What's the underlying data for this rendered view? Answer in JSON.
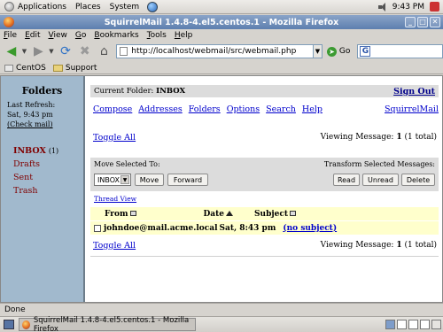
{
  "panel": {
    "applications": "Applications",
    "places": "Places",
    "system": "System",
    "clock": "9:43 PM"
  },
  "window": {
    "title": "SquirrelMail 1.4.8-4.el5.centos.1 - Mozilla Firefox",
    "controls": [
      "_",
      "□",
      "✕"
    ]
  },
  "menu": [
    {
      "label": "File",
      "key": "F",
      "rest": "ile"
    },
    {
      "label": "Edit",
      "key": "E",
      "rest": "dit"
    },
    {
      "label": "View",
      "key": "V",
      "rest": "iew"
    },
    {
      "label": "Go",
      "key": "G",
      "rest": "o"
    },
    {
      "label": "Bookmarks",
      "key": "B",
      "rest": "ookmarks"
    },
    {
      "label": "Tools",
      "key": "T",
      "rest": "ools"
    },
    {
      "label": "Help",
      "key": "H",
      "rest": "elp"
    }
  ],
  "nav": {
    "url": "http://localhost/webmail/src/webmail.php",
    "go_label": "Go"
  },
  "bookmarks": [
    "CentOS",
    "Support"
  ],
  "sidebar": {
    "title": "Folders",
    "refresh_label": "Last Refresh:",
    "refresh_time": "Sat, 9:43 pm",
    "check_mail": "(Check mail)",
    "folders": [
      {
        "name": "INBOX",
        "count": "(1)"
      },
      {
        "name": "Drafts"
      },
      {
        "name": "Sent"
      },
      {
        "name": "Trash"
      }
    ]
  },
  "main": {
    "current_folder_label": "Current Folder:",
    "current_folder": "INBOX",
    "sign_out": "Sign Out",
    "links": [
      "Compose",
      "Addresses",
      "Folders",
      "Options",
      "Search",
      "Help"
    ],
    "brand": "SquirrelMail",
    "toggle_all": "Toggle All",
    "viewing_prefix": "Viewing Message:",
    "viewing_num": "1",
    "viewing_total": "(1 total)",
    "move_selected_to": "Move Selected To:",
    "transform_label": "Transform Selected Messages:",
    "move_target": "INBOX",
    "move_btn": "Move",
    "forward_btn": "Forward",
    "read_btn": "Read",
    "unread_btn": "Unread",
    "delete_btn": "Delete",
    "thread_view": "Thread View",
    "columns": {
      "from": "From",
      "date": "Date",
      "subject": "Subject"
    },
    "messages": [
      {
        "from": "johndoe@mail.acme.local",
        "date": "Sat, 8:43 pm",
        "subject": "(no subject)"
      }
    ]
  },
  "status": "Done",
  "taskbar": {
    "task": "SquirrelMail 1.4.8-4.el5.centos.1 - Mozilla Firefox"
  }
}
